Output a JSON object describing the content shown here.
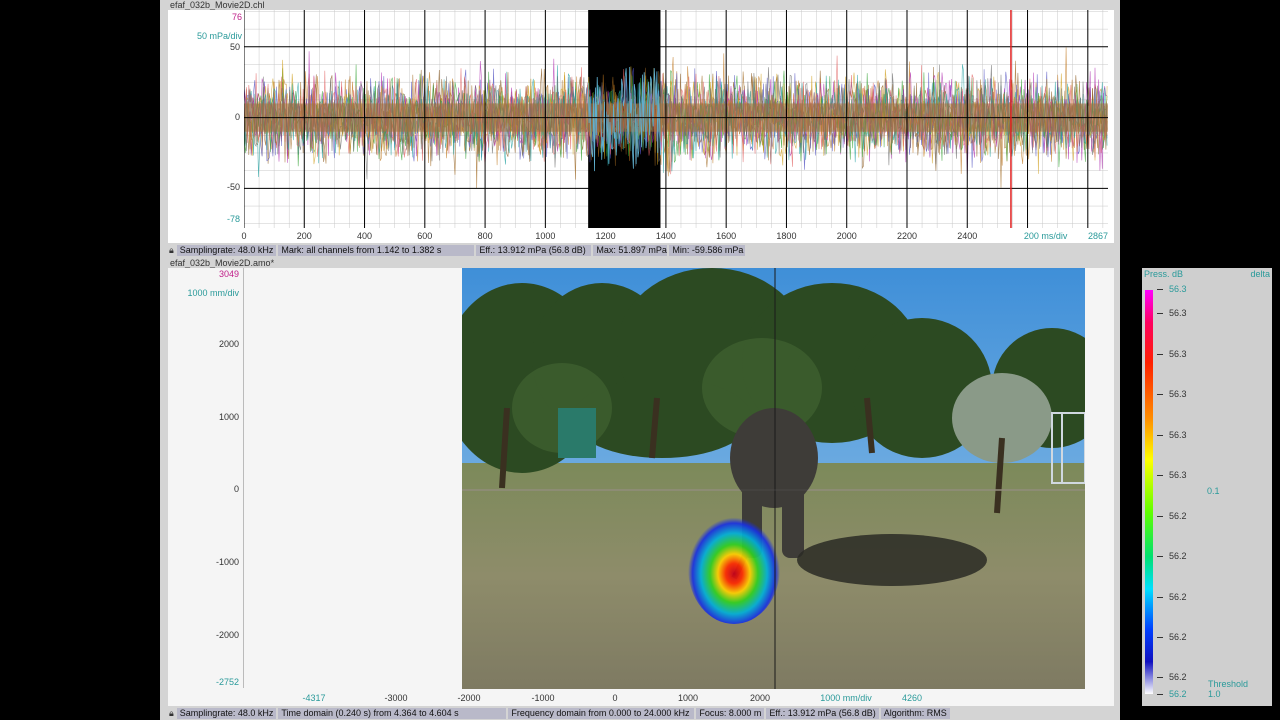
{
  "top_panel": {
    "title": "efaf_032b_Movie2D.chl",
    "y_max": "76",
    "y_scale": "50 mPa/div",
    "y_ticks": [
      "50",
      "0",
      "-50"
    ],
    "y_min": "-78",
    "x_ticks": [
      "0",
      "200",
      "400",
      "600",
      "800",
      "1000",
      "1200",
      "1400",
      "1600",
      "1800",
      "2000",
      "2200",
      "2400"
    ],
    "x_scale": "200 ms/div",
    "x_max": "2867",
    "status": {
      "samplingrate": "Samplingrate: 48.0 kHz",
      "mark": "Mark: all channels from 1.142 to 1.382 s",
      "eff": "Eff.: 13.912 mPa (56.8 dB)",
      "max": "Max: 51.897 mPa",
      "min": "Min: -59.586 mPa"
    }
  },
  "bottom_panel": {
    "title": "efaf_032b_Movie2D.amo*",
    "y_max": "3049",
    "y_scale": "1000 mm/div",
    "y_ticks": [
      "2000",
      "1000",
      "0",
      "-1000",
      "-2000"
    ],
    "y_min": "-2752",
    "x_min": "-4317",
    "x_ticks": [
      "-3000",
      "-2000",
      "-1000",
      "0",
      "1000",
      "2000"
    ],
    "x_scale": "1000 mm/div",
    "x_max": "4260",
    "status": {
      "samplingrate": "Samplingrate: 48.0 kHz",
      "time": "Time domain (0.240 s) from 4.364 to 4.604 s",
      "freq": "Frequency domain from 0.000 to 24.000 kHz",
      "focus": "Focus: 8.000 m",
      "eff": "Eff.: 13.912 mPa (56.8 dB)",
      "algorithm": "Algorithm: RMS"
    }
  },
  "colorbar": {
    "title": "Press. dB",
    "delta_label": "delta",
    "top_value": "56.3",
    "ticks": [
      "56.3",
      "56.3",
      "56.3",
      "56.3",
      "56.3",
      "56.2",
      "56.2",
      "56.2",
      "56.2",
      "56.2"
    ],
    "bottom_value": "56.2",
    "ratio": "0.1",
    "threshold_label": "Threshold",
    "threshold_value": "1.0"
  },
  "colors": {
    "grid": "#999999",
    "grid_major": "#000000",
    "marker_line": "#e02020",
    "axis_teal": "#2a9a9a",
    "axis_magenta": "#c0208a",
    "status_bg": "#b9b9c9"
  }
}
